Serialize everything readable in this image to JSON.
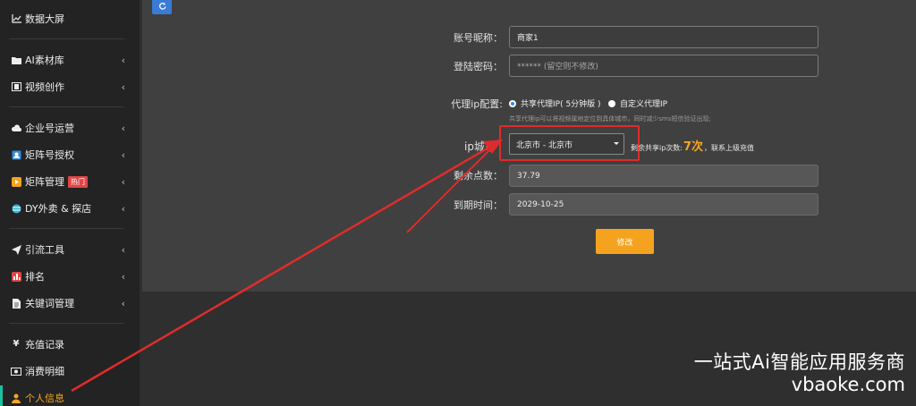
{
  "sidebar": {
    "items": [
      {
        "label": "数据大屏",
        "icon": "line-chart-icon"
      },
      {
        "label": "AI素材库",
        "icon": "folder-icon"
      },
      {
        "label": "视频创作",
        "icon": "film-icon"
      },
      {
        "label": "企业号运营",
        "icon": "cloud-icon"
      },
      {
        "label": "矩阵号授权",
        "icon": "portrait-icon"
      },
      {
        "label": "矩阵管理",
        "icon": "play-icon",
        "badge": "热门"
      },
      {
        "label": "DY外卖 & 探店",
        "icon": "globe-icon"
      },
      {
        "label": "引流工具",
        "icon": "send-icon"
      },
      {
        "label": "排名",
        "icon": "ranking-icon"
      },
      {
        "label": "关键词管理",
        "icon": "document-icon"
      },
      {
        "label": "充值记录",
        "icon": "yen-icon"
      },
      {
        "label": "消费明细",
        "icon": "money-icon"
      },
      {
        "label": "个人信息",
        "icon": "user-icon"
      }
    ]
  },
  "form": {
    "account_nickname_label": "账号昵称：",
    "account_nickname_value": "商家1",
    "password_label": "登陆密码：",
    "password_placeholder": "****** (留空则不修改)",
    "proxy_label": "代理ip配置:",
    "proxy_options": [
      "共享代理IP( 5分钟版 )",
      "自定义代理IP"
    ],
    "proxy_hint": "共享代理ip可以将视频属地定位到具体城市，同时减少sms短信验证出现;",
    "ip_city_label": "ip城市",
    "ip_city_value": "北京市 - 北京市",
    "remain_prefix": "剩余共享ip次数:",
    "remain_count": "7次",
    "remain_suffix": "，联系上级充值",
    "points_label": "剩余点数：",
    "points_value": "37.79",
    "expire_label": "到期时间：",
    "expire_value": "2029-10-25",
    "submit_label": "修改"
  },
  "watermark": {
    "line1": "一站式Ai智能应用服务商",
    "line2": "vbaoke.com"
  },
  "colors": {
    "accent": "#f5a31e",
    "annotation_red": "#e02b2b",
    "refresh_blue": "#3a7bd5"
  }
}
